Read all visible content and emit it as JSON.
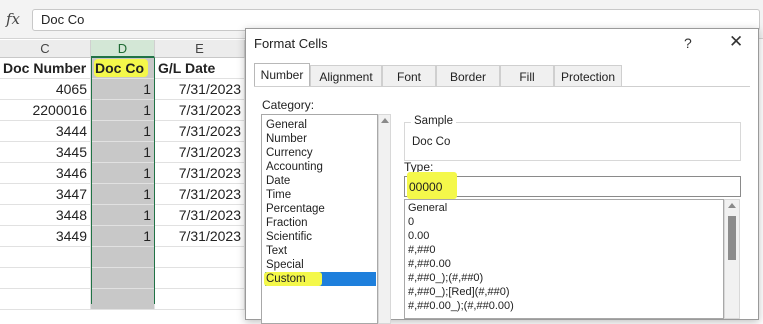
{
  "formula_bar": {
    "fx": "fx",
    "value": "Doc Co"
  },
  "columns": [
    {
      "letter": "C",
      "header": "Doc Number"
    },
    {
      "letter": "D",
      "header": "Doc Co"
    },
    {
      "letter": "E",
      "header": "G/L Date"
    }
  ],
  "rows": [
    {
      "doc_number": "4065",
      "doc_co": "1",
      "gl_date": "7/31/2023"
    },
    {
      "doc_number": "2200016",
      "doc_co": "1",
      "gl_date": "7/31/2023"
    },
    {
      "doc_number": "3444",
      "doc_co": "1",
      "gl_date": "7/31/2023"
    },
    {
      "doc_number": "3445",
      "doc_co": "1",
      "gl_date": "7/31/2023"
    },
    {
      "doc_number": "3446",
      "doc_co": "1",
      "gl_date": "7/31/2023"
    },
    {
      "doc_number": "3447",
      "doc_co": "1",
      "gl_date": "7/31/2023"
    },
    {
      "doc_number": "3448",
      "doc_co": "1",
      "gl_date": "7/31/2023"
    },
    {
      "doc_number": "3449",
      "doc_co": "1",
      "gl_date": "7/31/2023"
    }
  ],
  "dialog": {
    "title": "Format Cells",
    "help": "?",
    "close": "✕",
    "tabs": [
      "Number",
      "Alignment",
      "Font",
      "Border",
      "Fill",
      "Protection"
    ],
    "active_tab": "Number",
    "category_label": "Category:",
    "categories": [
      "General",
      "Number",
      "Currency",
      "Accounting",
      "Date",
      "Time",
      "Percentage",
      "Fraction",
      "Scientific",
      "Text",
      "Special",
      "Custom"
    ],
    "selected_category": "Custom",
    "sample_label": "Sample",
    "sample_value": "Doc Co",
    "type_label": "Type:",
    "type_value": "00000",
    "type_list": [
      "General",
      "0",
      "0.00",
      "#,##0",
      "#,##0.00",
      "#,##0_);(#,##0)",
      "#,##0_);[Red](#,##0)",
      "#,##0.00_);(#,##0.00)"
    ]
  },
  "colors": {
    "highlight": "#f4f84a",
    "selection_blue": "#1e7fdc",
    "excel_green": "#217346"
  }
}
